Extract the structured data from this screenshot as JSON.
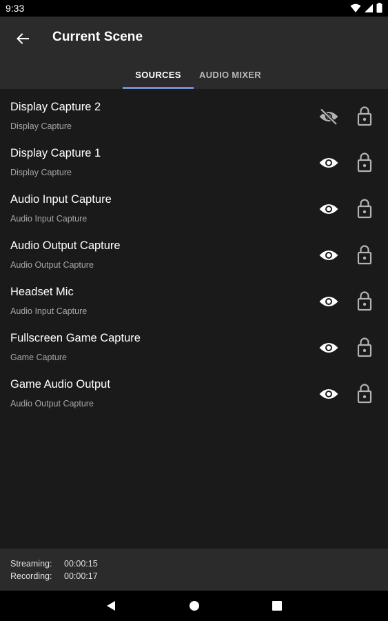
{
  "status_bar": {
    "time": "9:33"
  },
  "app_bar": {
    "title": "Current Scene"
  },
  "tabs": [
    {
      "label": "SOURCES",
      "selected": true
    },
    {
      "label": "AUDIO MIXER",
      "selected": false
    }
  ],
  "sources": [
    {
      "name": "Display Capture 2",
      "type": "Display Capture",
      "visible": false,
      "locked": false
    },
    {
      "name": "Display Capture 1",
      "type": "Display Capture",
      "visible": true,
      "locked": false
    },
    {
      "name": "Audio Input Capture",
      "type": "Audio Input Capture",
      "visible": true,
      "locked": false
    },
    {
      "name": "Audio Output Capture",
      "type": "Audio Output Capture",
      "visible": true,
      "locked": false
    },
    {
      "name": "Headset Mic",
      "type": "Audio Input Capture",
      "visible": true,
      "locked": false
    },
    {
      "name": "Fullscreen Game Capture",
      "type": "Game Capture",
      "visible": true,
      "locked": false
    },
    {
      "name": "Game Audio Output",
      "type": "Audio Output Capture",
      "visible": true,
      "locked": false
    }
  ],
  "footer": {
    "streaming_label": "Streaming:",
    "streaming_value": "00:00:15",
    "recording_label": "Recording:",
    "recording_value": "00:00:17"
  },
  "colors": {
    "accent": "#6f8fd6",
    "app_bar": "#2b2b2b",
    "background": "#1a1a1a"
  },
  "icons": {
    "back": "arrow-left-icon",
    "visible": "eye-icon",
    "hidden": "eye-off-icon",
    "lock": "lock-open-icon",
    "nav_back": "triangle-back-icon",
    "nav_home": "circle-home-icon",
    "nav_recents": "square-recents-icon"
  }
}
